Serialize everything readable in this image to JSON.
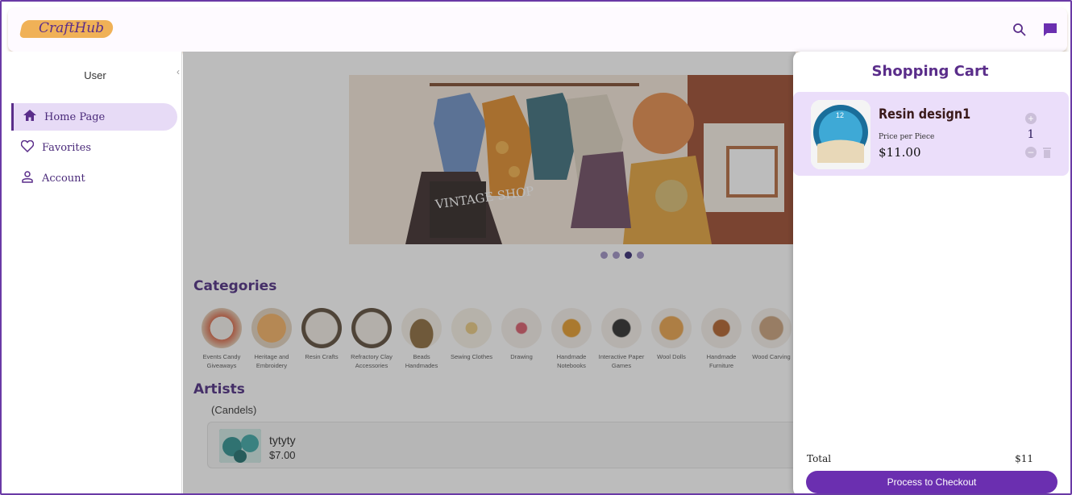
{
  "app": {
    "logo_text": "CraftHub"
  },
  "header": {
    "icons": [
      "search-icon",
      "chat-icon"
    ]
  },
  "sidebar": {
    "user_label": "User",
    "items": [
      {
        "label": "Home Page",
        "icon": "home-icon",
        "active": true
      },
      {
        "label": "Favorites",
        "icon": "heart-icon",
        "active": false
      },
      {
        "label": "Account",
        "icon": "person-icon",
        "active": false
      }
    ]
  },
  "main": {
    "banner_sign": "VINTAGE SHOP",
    "carousel": {
      "count": 4,
      "active_index": 2
    },
    "categories_title": "Categories",
    "categories": [
      "Events Candy Giveaways",
      "Heritage and Embroidery",
      "Resin Crafts",
      "Refractory Clay Accessories",
      "Beads Handmades",
      "Sewing Clothes",
      "Drawing",
      "Handmade Notebooks",
      "Interactive Paper Games",
      "Wool Dolls",
      "Handmade Furniture",
      "Wood Carving"
    ],
    "artists_title": "Artists",
    "artist_tag": "(Candels)",
    "artist_card": {
      "name": "tytyty",
      "price": "$7.00"
    }
  },
  "cart": {
    "title": "Shopping Cart",
    "items": [
      {
        "name": "Resin design1",
        "price_label": "Price per Piece",
        "price": "$11.00",
        "quantity": "1",
        "image_label": "12"
      }
    ],
    "total_label": "Total",
    "total_value": "$11",
    "checkout_label": "Process to Checkout"
  },
  "colors": {
    "brand": "#5a2d8a",
    "accent": "#6b2fb0",
    "highlight": "#ebdefa"
  }
}
